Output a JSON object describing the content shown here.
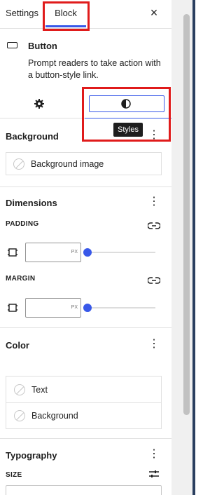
{
  "header": {
    "tabs": [
      {
        "label": "Settings",
        "active": false
      },
      {
        "label": "Block",
        "active": true
      }
    ],
    "close_icon": "close-icon",
    "close_glyph": "×"
  },
  "block_card": {
    "icon": "button-block-icon",
    "title": "Button",
    "description": "Prompt readers to take action with a button-style link."
  },
  "inspector_tabs": {
    "settings_icon": "gear-icon",
    "styles_icon": "half-circle-icon",
    "active": "styles"
  },
  "tooltip": {
    "text": "Styles"
  },
  "background": {
    "title": "Background",
    "menu_glyph": "⋮",
    "image_label": "Background image"
  },
  "dimensions": {
    "title": "Dimensions",
    "menu_glyph": "⋮",
    "padding": {
      "label": "PADDING",
      "value": "",
      "unit": "PX",
      "slider": 0
    },
    "margin": {
      "label": "MARGIN",
      "value": "",
      "unit": "PX",
      "slider": 0
    }
  },
  "color": {
    "title": "Color",
    "menu_glyph": "⋮",
    "items": [
      {
        "label": "Text"
      },
      {
        "label": "Background"
      }
    ]
  },
  "typography": {
    "title": "Typography",
    "menu_glyph": "⋮",
    "size_label": "SIZE"
  },
  "colors": {
    "accent": "#3858e9",
    "annotation": "#e01b1b",
    "tooltip_bg": "#1e1e1e"
  }
}
